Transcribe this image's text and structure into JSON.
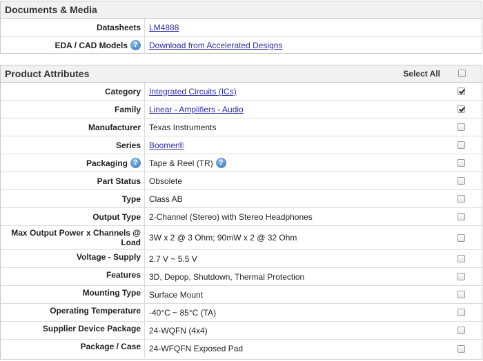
{
  "docs": {
    "title": "Documents & Media",
    "rows": [
      {
        "label": "Datasheets",
        "value": "LM4888",
        "link": true,
        "help": false
      },
      {
        "label": "EDA / CAD Models",
        "value": "Download from Accelerated Designs",
        "link": true,
        "help": true
      }
    ]
  },
  "attrs": {
    "title": "Product Attributes",
    "select_all": "Select All",
    "rows": [
      {
        "label": "Category",
        "value": "Integrated Circuits (ICs)",
        "link": true,
        "checked": true
      },
      {
        "label": "Family",
        "value": "Linear - Amplifiers - Audio",
        "link": true,
        "checked": true
      },
      {
        "label": "Manufacturer",
        "value": "Texas Instruments",
        "link": false,
        "checked": false
      },
      {
        "label": "Series",
        "value": "Boomer®",
        "link": true,
        "checked": false
      },
      {
        "label": "Packaging",
        "value": "Tape & Reel (TR)",
        "link": false,
        "checked": false
      },
      {
        "label": "Part Status",
        "value": "Obsolete",
        "link": false,
        "checked": false
      },
      {
        "label": "Type",
        "value": "Class AB",
        "link": false,
        "checked": false
      },
      {
        "label": "Output Type",
        "value": "2-Channel (Stereo) with Stereo Headphones",
        "link": false,
        "checked": false
      },
      {
        "label": "Max Output Power x Channels @ Load",
        "value": "3W x 2 @ 3 Ohm; 90mW x 2 @ 32 Ohm",
        "link": false,
        "checked": false
      },
      {
        "label": "Voltage - Supply",
        "value": "2.7 V ~ 5.5 V",
        "link": false,
        "checked": false
      },
      {
        "label": "Features",
        "value": "3D, Depop, Shutdown, Thermal Protection",
        "link": false,
        "checked": false
      },
      {
        "label": "Mounting Type",
        "value": "Surface Mount",
        "link": false,
        "checked": false
      },
      {
        "label": "Operating Temperature",
        "value": "-40°C ~ 85°C (TA)",
        "link": false,
        "checked": false
      },
      {
        "label": "Supplier Device Package",
        "value": "24-WQFN (4x4)",
        "link": false,
        "checked": false
      },
      {
        "label": "Package / Case",
        "value": "24-WFQFN Exposed Pad",
        "link": false,
        "checked": false
      }
    ]
  },
  "help_glyph": "?",
  "icons": {
    "help": "help-icon",
    "checkbox": "checkbox"
  }
}
